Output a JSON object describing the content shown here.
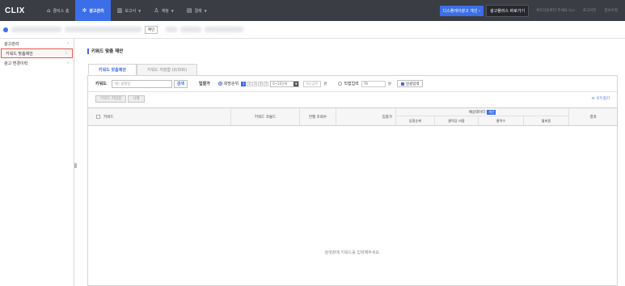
{
  "app": {
    "logo": "CLIX"
  },
  "nav": {
    "items": [
      {
        "label": "클릭스 홈",
        "icon": "home-icon",
        "glyph": "⌂",
        "active": false,
        "dropdown": false
      },
      {
        "label": "광고관리",
        "icon": "gear-icon",
        "glyph": "✲",
        "active": true,
        "dropdown": false
      },
      {
        "label": "보고서",
        "icon": "chart-icon",
        "glyph": "▥",
        "active": false,
        "dropdown": true
      },
      {
        "label": "계정",
        "icon": "user-icon",
        "glyph": "♙",
        "active": false,
        "dropdown": true
      },
      {
        "label": "결제",
        "icon": "card-icon",
        "glyph": "▤",
        "active": false,
        "dropdown": true
      }
    ],
    "right_buttons": {
      "blue": "디스플레이광고 개선 ›",
      "dark": "광고플러스 바로가기"
    },
    "right_links": [
      "위드다운로더 주세요 (노)",
      "로그아웃",
      "정보수정"
    ]
  },
  "account": {
    "button": "확인"
  },
  "sidebar": {
    "items": [
      {
        "label": "광고관리",
        "active": false
      },
      {
        "label": "키워드 맞춤제안",
        "active": true
      },
      {
        "label": "광고 변경이력",
        "active": false
      }
    ]
  },
  "main": {
    "title": "키워드 맞춤 제안",
    "tabs": [
      {
        "label": "키워드 맞춤제안",
        "active": true
      },
      {
        "label": "키워드 저장함 (0/300)",
        "active": false
      }
    ],
    "filter": {
      "keyword_label": "키워드",
      "keyword_placeholder": "예) 꽃배달",
      "search_button": "검색",
      "bid_label": "입찰가",
      "option_rank": "희망순위",
      "ranks": [
        "1",
        "2",
        "3",
        "4",
        "5"
      ],
      "range_select": "6~10순위",
      "min_placeholder": "최소금액",
      "unit_won": "원",
      "option_direct": "직접입력",
      "direct_value": "70",
      "unit_won2": "원",
      "bulk_button": "일괄입력"
    },
    "actions": {
      "save_button": "키워드 저장함",
      "delete_button": "삭제",
      "collapse_link": "모두접기"
    },
    "table": {
      "col_keyword": "키워드",
      "col_code": "키워드 코믈드",
      "col_monthly": "전월 조회수",
      "col_bid": "입찰가",
      "group_label": "예상데이터",
      "calc_badge": "계산",
      "sub_rank": "입찰순위",
      "sub_cpc": "클릭당 비용",
      "sub_clicks": "클릭수",
      "sub_cost": "월비용",
      "col_result": "결과"
    },
    "empty_message": "검색창에 키워드를 입력해주세요."
  }
}
